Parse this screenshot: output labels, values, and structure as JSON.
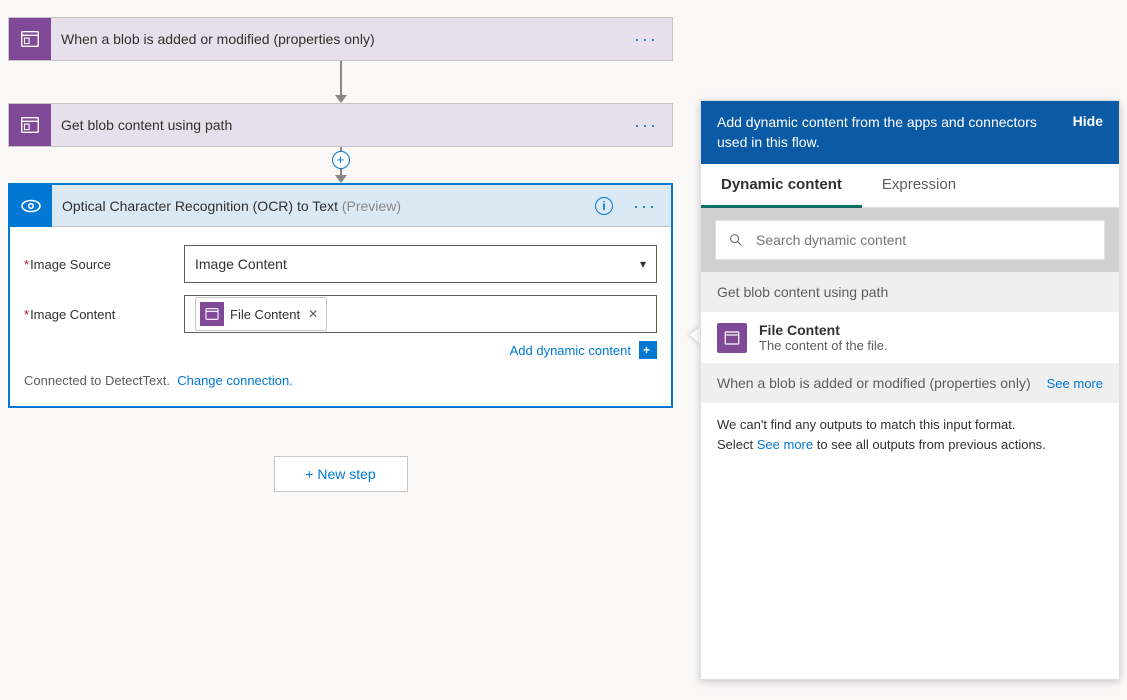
{
  "flow": {
    "trigger": {
      "title": "When a blob is added or modified (properties only)"
    },
    "action1": {
      "title": "Get blob content using path"
    },
    "ocr": {
      "title": "Optical Character Recognition (OCR) to Text",
      "preview": "(Preview)",
      "fields": {
        "image_source_label": "Image Source",
        "image_source_value": "Image Content",
        "image_content_label": "Image Content",
        "token_label": "File Content"
      },
      "add_dynamic": "Add dynamic content",
      "connected_prefix": "Connected to DetectText.",
      "change_conn": "Change connection."
    },
    "new_step": "+ New step"
  },
  "panel": {
    "header_text": "Add dynamic content from the apps and connectors used in this flow.",
    "hide": "Hide",
    "tabs": {
      "dynamic": "Dynamic content",
      "expression": "Expression"
    },
    "search_placeholder": "Search dynamic content",
    "group1": {
      "title": "Get blob content using path",
      "item_title": "File Content",
      "item_desc": "The content of the file."
    },
    "group2": {
      "title": "When a blob is added or modified (properties only)",
      "see_more": "See more",
      "no_outputs_line1": "We can't find any outputs to match this input format.",
      "no_outputs_pre": "Select ",
      "no_outputs_link": "See more",
      "no_outputs_post": " to see all outputs from previous actions."
    }
  }
}
